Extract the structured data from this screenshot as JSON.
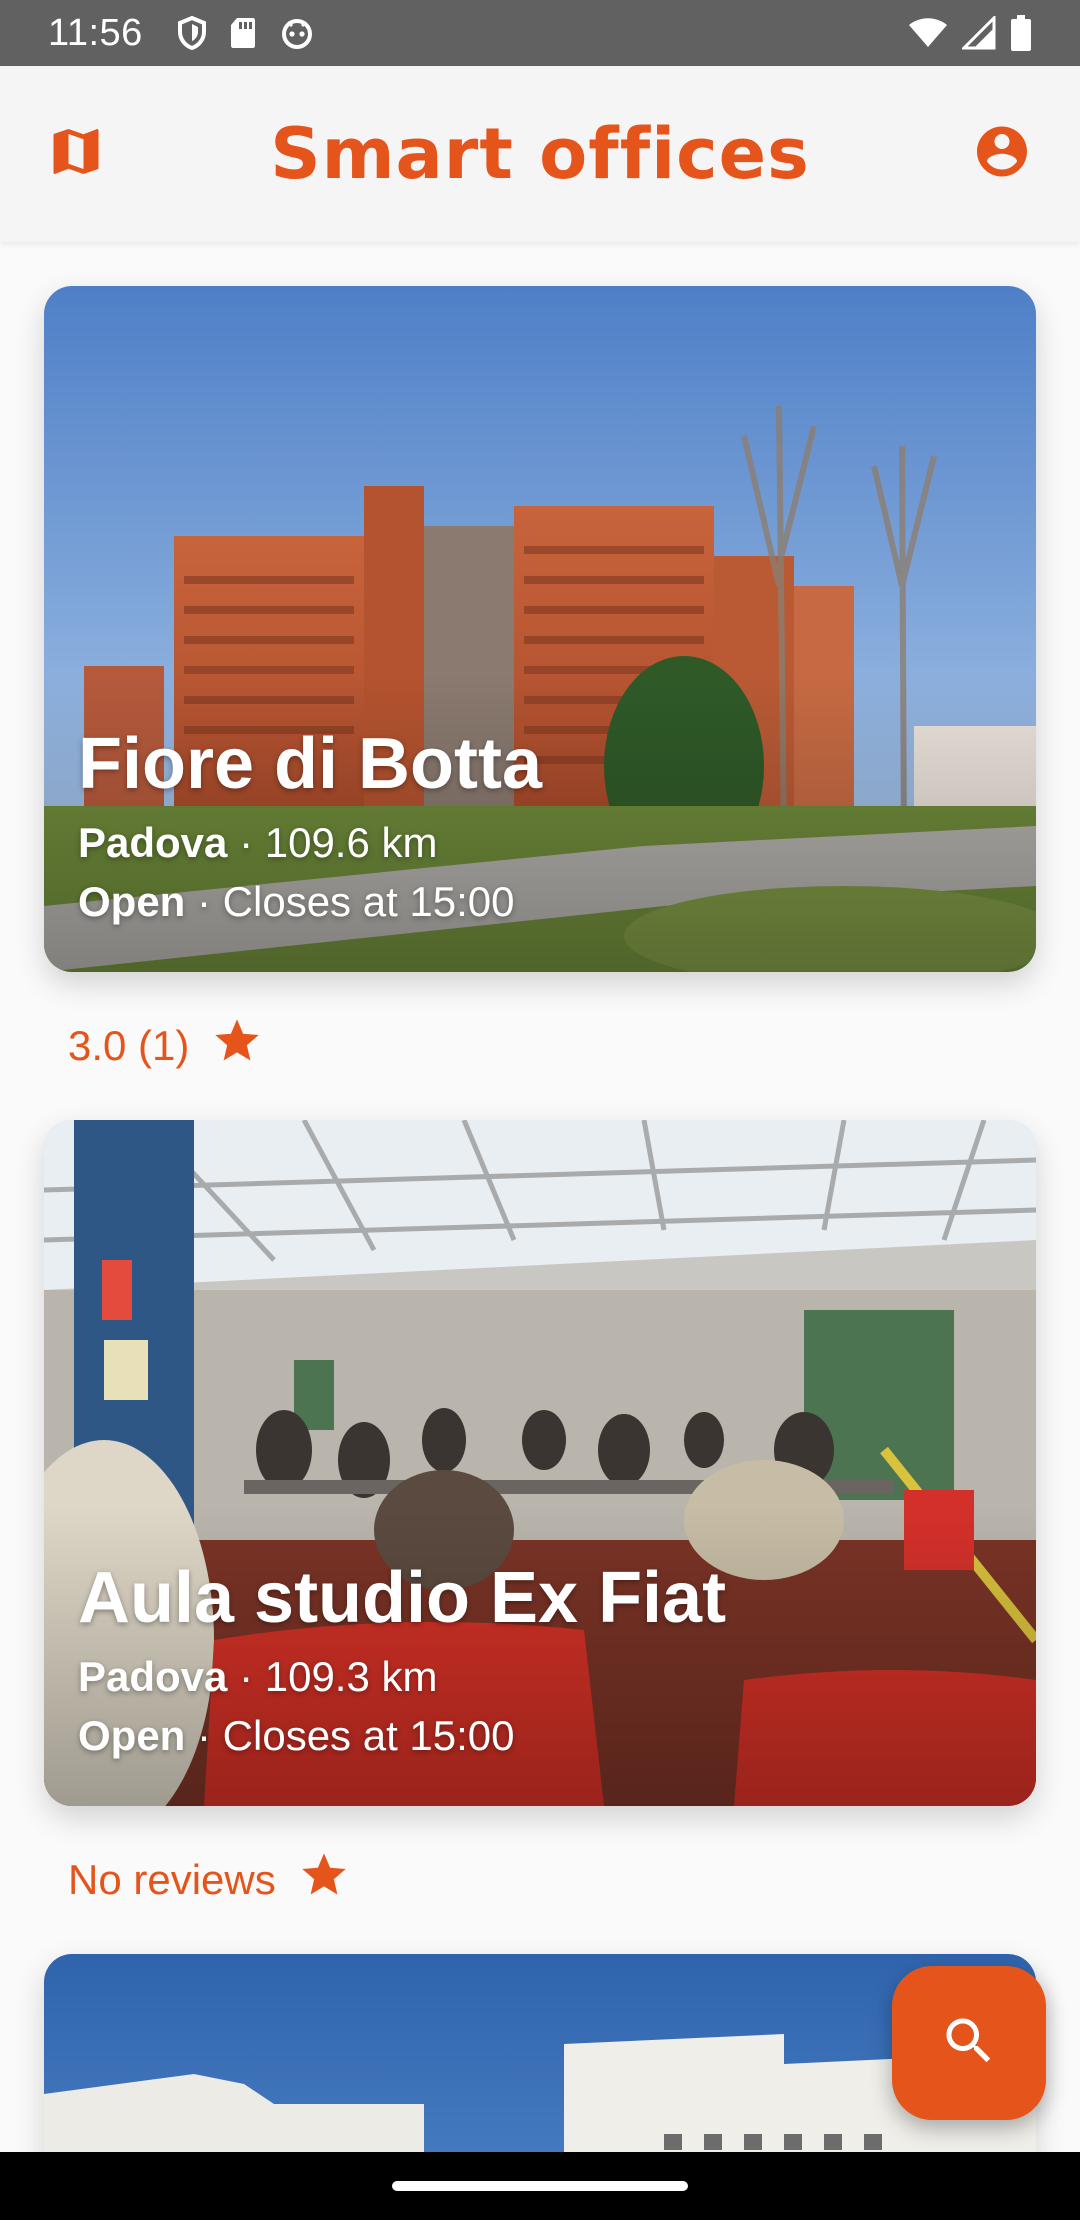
{
  "status_bar": {
    "time": "11:56",
    "icons": [
      "shield-icon",
      "sd-card-icon",
      "android-debug-icon"
    ],
    "right_icons": [
      "wifi-icon",
      "cell-signal-icon",
      "battery-icon"
    ]
  },
  "app_bar": {
    "title": "Smart offices",
    "left_icon": "map-icon",
    "right_icon": "account-circle-icon"
  },
  "offices": [
    {
      "name": "Fiore di Botta",
      "city": "Padova",
      "distance": "109.6 km",
      "status": "Open",
      "closes": "Closes at 15:00",
      "rating": "3.0 (1)"
    },
    {
      "name": "Aula studio Ex Fiat",
      "city": "Padova",
      "distance": "109.3 km",
      "status": "Open",
      "closes": "Closes at 15:00",
      "rating": "No reviews"
    }
  ],
  "separator": " · ",
  "fab": {
    "icon": "search-icon"
  },
  "colors": {
    "accent": "#e5551b",
    "status_bar": "#616161",
    "app_bar": "#f5f5f5",
    "background": "#fafafa"
  }
}
